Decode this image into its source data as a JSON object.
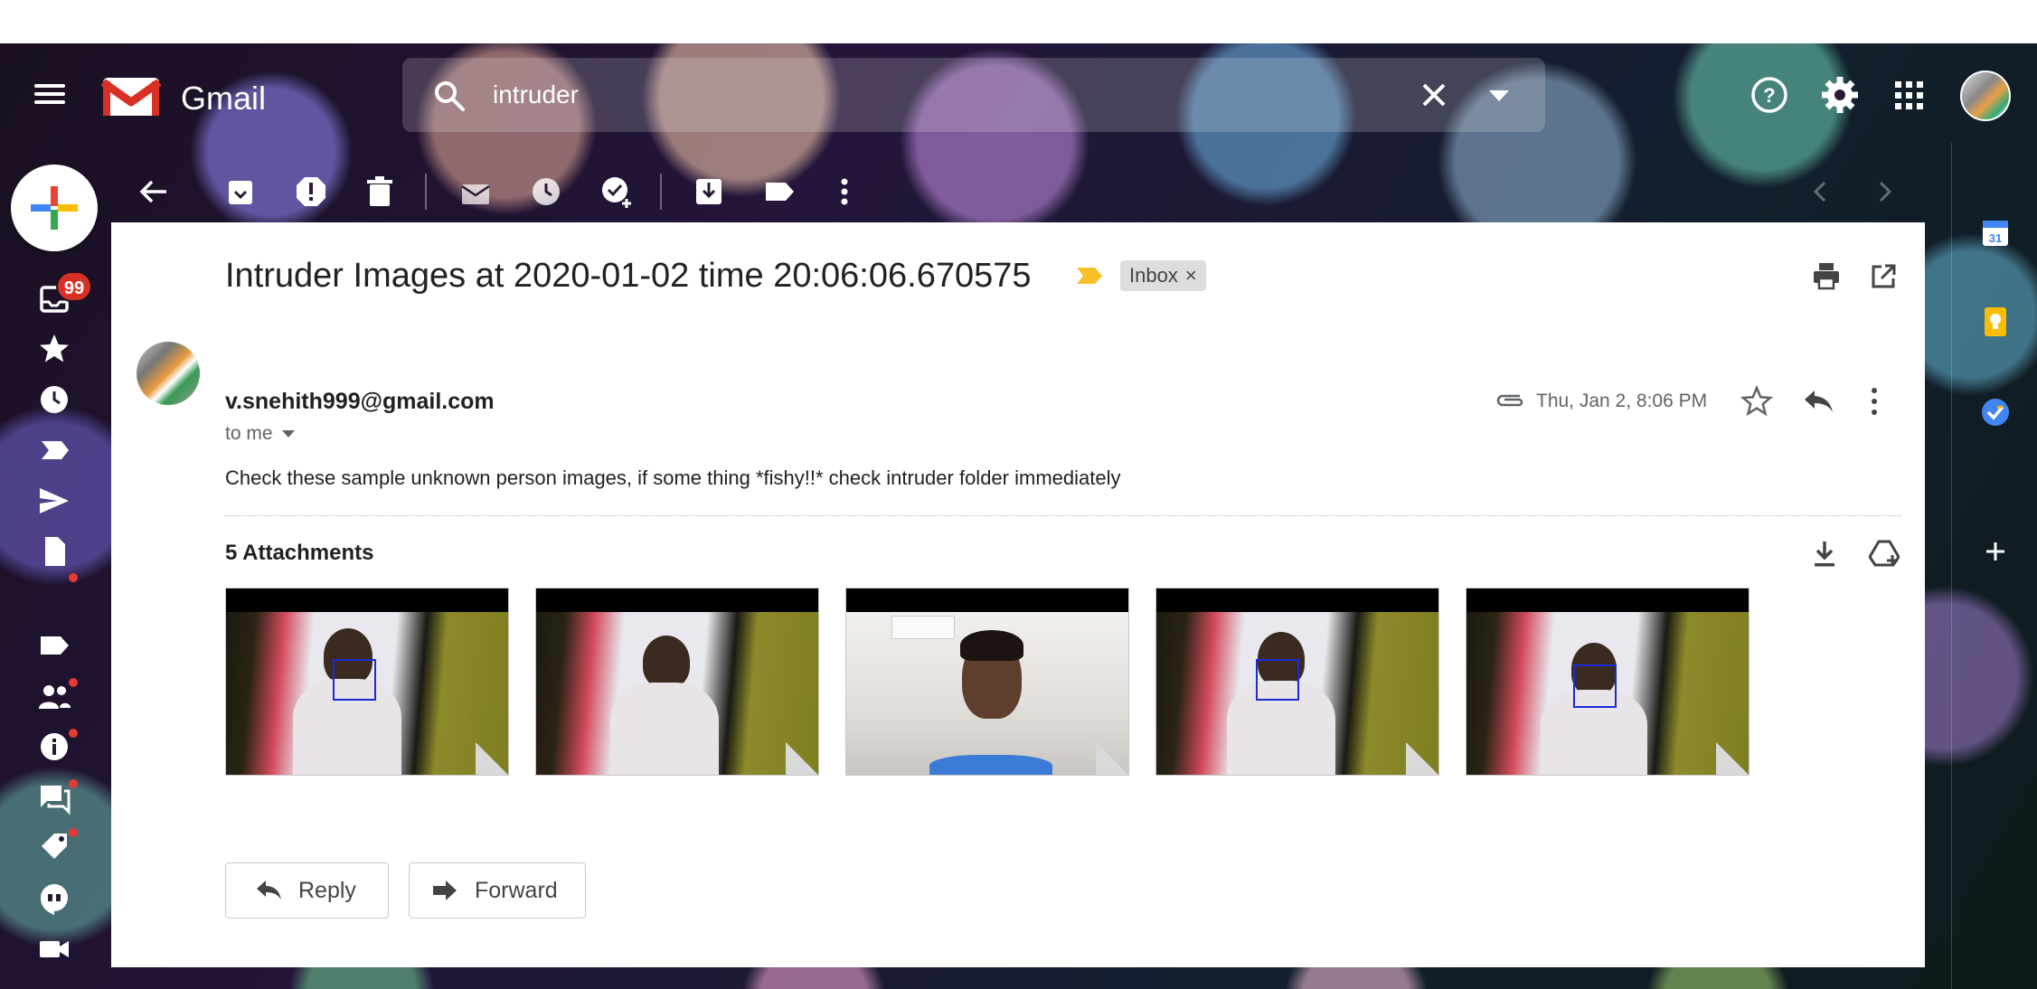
{
  "app": {
    "name": "Gmail"
  },
  "search": {
    "query": "intruder"
  },
  "nav": {
    "inbox_badge": "99"
  },
  "email": {
    "subject": "Intruder Images at 2020-01-02 time 20:06:06.670575",
    "label": "Inbox",
    "label_remove": "×",
    "sender": "v.snehith999@gmail.com",
    "recipient": "to me",
    "date": "Thu, Jan 2, 8:06 PM",
    "body": "Check these sample unknown person images, if some thing *fishy!!* check intruder folder immediately",
    "attachments_title": "5 Attachments"
  },
  "actions": {
    "reply": "Reply",
    "forward": "Forward"
  },
  "colors": {
    "accent_red": "#d93025",
    "facebox": "#1a2bd9",
    "label_yellow": "#f6c026"
  }
}
